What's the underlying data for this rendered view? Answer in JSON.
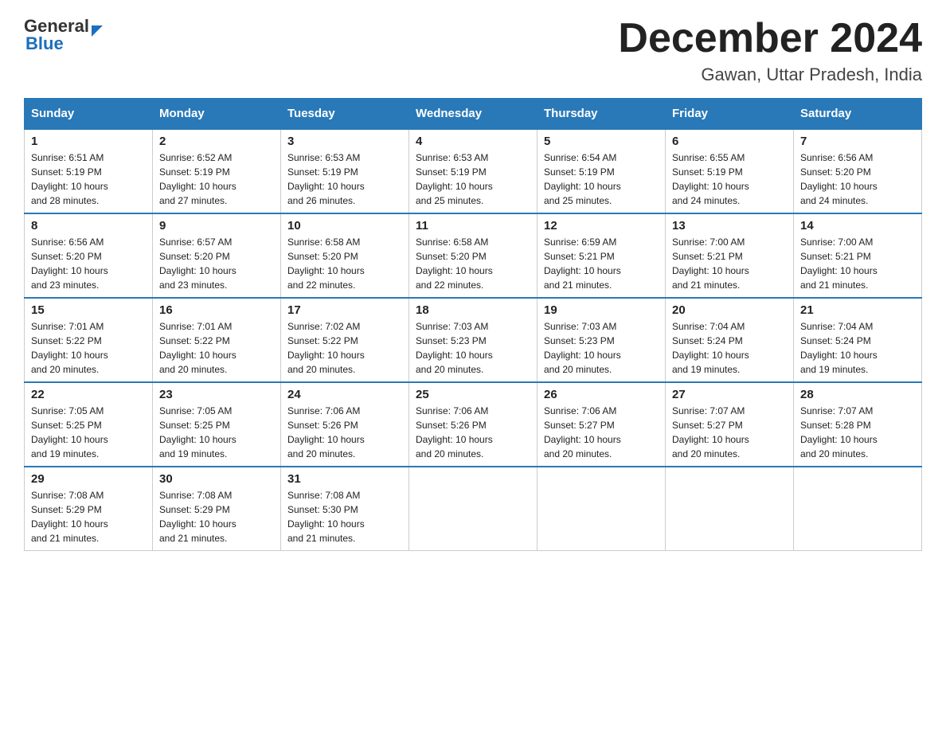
{
  "header": {
    "logo_general": "General",
    "logo_blue": "Blue",
    "month_title": "December 2024",
    "location": "Gawan, Uttar Pradesh, India"
  },
  "weekdays": [
    "Sunday",
    "Monday",
    "Tuesday",
    "Wednesday",
    "Thursday",
    "Friday",
    "Saturday"
  ],
  "weeks": [
    [
      {
        "day": "1",
        "sunrise": "6:51 AM",
        "sunset": "5:19 PM",
        "daylight": "10 hours and 28 minutes."
      },
      {
        "day": "2",
        "sunrise": "6:52 AM",
        "sunset": "5:19 PM",
        "daylight": "10 hours and 27 minutes."
      },
      {
        "day": "3",
        "sunrise": "6:53 AM",
        "sunset": "5:19 PM",
        "daylight": "10 hours and 26 minutes."
      },
      {
        "day": "4",
        "sunrise": "6:53 AM",
        "sunset": "5:19 PM",
        "daylight": "10 hours and 25 minutes."
      },
      {
        "day": "5",
        "sunrise": "6:54 AM",
        "sunset": "5:19 PM",
        "daylight": "10 hours and 25 minutes."
      },
      {
        "day": "6",
        "sunrise": "6:55 AM",
        "sunset": "5:19 PM",
        "daylight": "10 hours and 24 minutes."
      },
      {
        "day": "7",
        "sunrise": "6:56 AM",
        "sunset": "5:20 PM",
        "daylight": "10 hours and 24 minutes."
      }
    ],
    [
      {
        "day": "8",
        "sunrise": "6:56 AM",
        "sunset": "5:20 PM",
        "daylight": "10 hours and 23 minutes."
      },
      {
        "day": "9",
        "sunrise": "6:57 AM",
        "sunset": "5:20 PM",
        "daylight": "10 hours and 23 minutes."
      },
      {
        "day": "10",
        "sunrise": "6:58 AM",
        "sunset": "5:20 PM",
        "daylight": "10 hours and 22 minutes."
      },
      {
        "day": "11",
        "sunrise": "6:58 AM",
        "sunset": "5:20 PM",
        "daylight": "10 hours and 22 minutes."
      },
      {
        "day": "12",
        "sunrise": "6:59 AM",
        "sunset": "5:21 PM",
        "daylight": "10 hours and 21 minutes."
      },
      {
        "day": "13",
        "sunrise": "7:00 AM",
        "sunset": "5:21 PM",
        "daylight": "10 hours and 21 minutes."
      },
      {
        "day": "14",
        "sunrise": "7:00 AM",
        "sunset": "5:21 PM",
        "daylight": "10 hours and 21 minutes."
      }
    ],
    [
      {
        "day": "15",
        "sunrise": "7:01 AM",
        "sunset": "5:22 PM",
        "daylight": "10 hours and 20 minutes."
      },
      {
        "day": "16",
        "sunrise": "7:01 AM",
        "sunset": "5:22 PM",
        "daylight": "10 hours and 20 minutes."
      },
      {
        "day": "17",
        "sunrise": "7:02 AM",
        "sunset": "5:22 PM",
        "daylight": "10 hours and 20 minutes."
      },
      {
        "day": "18",
        "sunrise": "7:03 AM",
        "sunset": "5:23 PM",
        "daylight": "10 hours and 20 minutes."
      },
      {
        "day": "19",
        "sunrise": "7:03 AM",
        "sunset": "5:23 PM",
        "daylight": "10 hours and 20 minutes."
      },
      {
        "day": "20",
        "sunrise": "7:04 AM",
        "sunset": "5:24 PM",
        "daylight": "10 hours and 19 minutes."
      },
      {
        "day": "21",
        "sunrise": "7:04 AM",
        "sunset": "5:24 PM",
        "daylight": "10 hours and 19 minutes."
      }
    ],
    [
      {
        "day": "22",
        "sunrise": "7:05 AM",
        "sunset": "5:25 PM",
        "daylight": "10 hours and 19 minutes."
      },
      {
        "day": "23",
        "sunrise": "7:05 AM",
        "sunset": "5:25 PM",
        "daylight": "10 hours and 19 minutes."
      },
      {
        "day": "24",
        "sunrise": "7:06 AM",
        "sunset": "5:26 PM",
        "daylight": "10 hours and 20 minutes."
      },
      {
        "day": "25",
        "sunrise": "7:06 AM",
        "sunset": "5:26 PM",
        "daylight": "10 hours and 20 minutes."
      },
      {
        "day": "26",
        "sunrise": "7:06 AM",
        "sunset": "5:27 PM",
        "daylight": "10 hours and 20 minutes."
      },
      {
        "day": "27",
        "sunrise": "7:07 AM",
        "sunset": "5:27 PM",
        "daylight": "10 hours and 20 minutes."
      },
      {
        "day": "28",
        "sunrise": "7:07 AM",
        "sunset": "5:28 PM",
        "daylight": "10 hours and 20 minutes."
      }
    ],
    [
      {
        "day": "29",
        "sunrise": "7:08 AM",
        "sunset": "5:29 PM",
        "daylight": "10 hours and 21 minutes."
      },
      {
        "day": "30",
        "sunrise": "7:08 AM",
        "sunset": "5:29 PM",
        "daylight": "10 hours and 21 minutes."
      },
      {
        "day": "31",
        "sunrise": "7:08 AM",
        "sunset": "5:30 PM",
        "daylight": "10 hours and 21 minutes."
      },
      null,
      null,
      null,
      null
    ]
  ],
  "labels": {
    "sunrise": "Sunrise:",
    "sunset": "Sunset:",
    "daylight": "Daylight:"
  }
}
